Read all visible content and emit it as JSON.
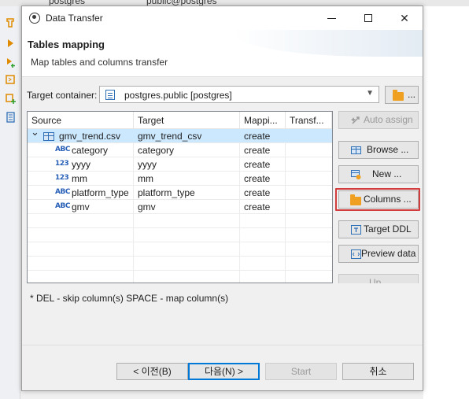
{
  "background": {
    "topbar_fragments": [
      "postgres",
      "public@postgres"
    ]
  },
  "dialog": {
    "title": "Data Transfer",
    "header": {
      "title": "Tables mapping",
      "subtitle": "Map tables and columns transfer"
    },
    "target": {
      "label": "Target container:",
      "value": "postgres.public  [postgres]",
      "browse_label": "..."
    },
    "table": {
      "columns": [
        "Source",
        "Target",
        "Mappi...",
        "Transf..."
      ],
      "rows": [
        {
          "icon": "table-icon",
          "source": "gmv_trend.csv",
          "target": "gmv_trend_csv",
          "mapping": "create",
          "transform": "",
          "level": 0,
          "selected": true
        },
        {
          "icon": "ABC",
          "source": "category",
          "target": "category",
          "mapping": "create",
          "transform": "",
          "level": 1
        },
        {
          "icon": "123",
          "source": "yyyy",
          "target": "yyyy",
          "mapping": "create",
          "transform": "",
          "level": 1
        },
        {
          "icon": "123",
          "source": "mm",
          "target": "mm",
          "mapping": "create",
          "transform": "",
          "level": 1
        },
        {
          "icon": "ABC",
          "source": "platform_type",
          "target": "platform_type",
          "mapping": "create",
          "transform": "",
          "level": 1
        },
        {
          "icon": "ABC",
          "source": "gmv",
          "target": "gmv",
          "mapping": "create",
          "transform": "",
          "level": 1
        }
      ]
    },
    "side_buttons": {
      "auto_assign": "Auto assign",
      "browse": "Browse ...",
      "new": "New ...",
      "columns": "Columns ...",
      "target_ddl": "Target DDL",
      "preview_data": "Preview data",
      "up": "Up"
    },
    "hint": "* DEL - skip column(s)  SPACE - map column(s)",
    "footer": {
      "back": "< 이전(B)",
      "next": "다음(N) >",
      "start": "Start",
      "cancel": "취소"
    }
  },
  "colors": {
    "selection": "#cce8ff",
    "highlight": "#d23c3c",
    "type_icon": "#2860b8",
    "folder": "#f0a020"
  }
}
